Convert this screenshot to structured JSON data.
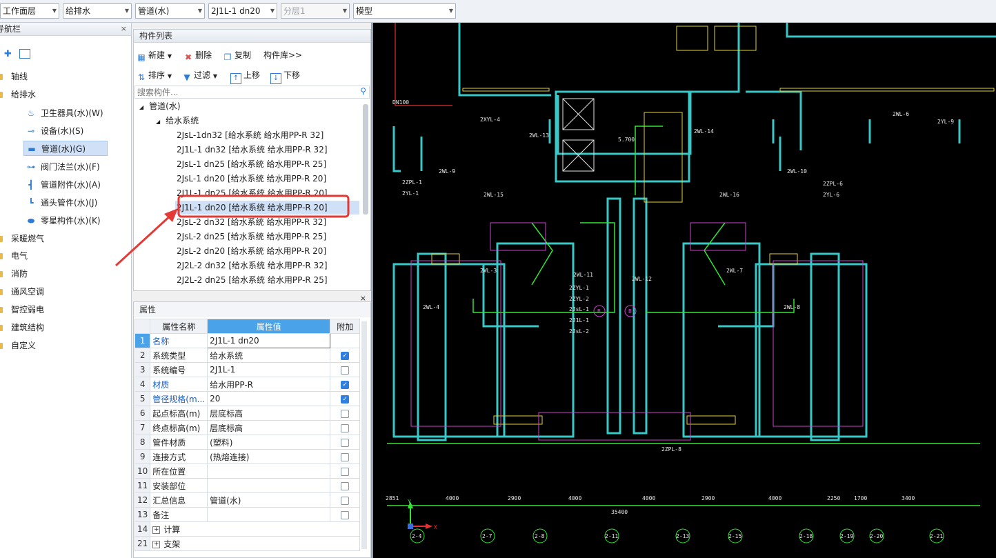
{
  "toolbar": {
    "combos": [
      {
        "value": "工作面层",
        "disabled": false
      },
      {
        "value": "给排水",
        "disabled": false
      },
      {
        "value": "管道(水)",
        "disabled": false
      },
      {
        "value": "2J1L-1 dn20",
        "disabled": false
      },
      {
        "value": "分层1",
        "disabled": true
      },
      {
        "value": "模型",
        "disabled": false
      }
    ]
  },
  "nav": {
    "title": "导航栏",
    "close": "×",
    "categories": [
      {
        "label": "轴线"
      },
      {
        "label": "给排水"
      },
      {
        "label": "采暖燃气"
      },
      {
        "label": "电气"
      },
      {
        "label": "消防"
      },
      {
        "label": "通风空调"
      },
      {
        "label": "智控弱电"
      },
      {
        "label": "建筑结构"
      },
      {
        "label": "自定义"
      }
    ],
    "sub_items": [
      {
        "label": "卫生器具(水)(W)",
        "icon": "sink-icon"
      },
      {
        "label": "设备(水)(S)",
        "icon": "equipment-icon"
      },
      {
        "label": "管道(水)(G)",
        "icon": "pipe-icon"
      },
      {
        "label": "阀门法兰(水)(F)",
        "icon": "valve-icon"
      },
      {
        "label": "管道附件(水)(A)",
        "icon": "fitting-icon"
      },
      {
        "label": "通头管件(水)(J)",
        "icon": "elbow-icon"
      },
      {
        "label": "零星构件(水)(K)",
        "icon": "misc-icon"
      }
    ],
    "selected_sub_index": 2
  },
  "component_list": {
    "title": "构件列表",
    "close": "×",
    "buttons": {
      "new": "新建",
      "delete": "删除",
      "copy": "复制",
      "library": "构件库>>",
      "sort": "排序",
      "filter": "过滤",
      "move_up": "上移",
      "move_down": "下移"
    },
    "search_placeholder": "搜索构件...",
    "tree_root": "管道(水)",
    "tree_group": "给水系统",
    "items": [
      "2JsL-1dn32 [给水系统 给水用PP-R 32]",
      "2J1L-1 dn32 [给水系统 给水用PP-R 32]",
      "2JsL-1 dn25 [给水系统 给水用PP-R 25]",
      "2JsL-1 dn20 [给水系统 给水用PP-R 20]",
      "2J1L-1 dn25 [给水系统 给水用PP-R 20]",
      "2J1L-1 dn20 [给水系统 给水用PP-R 20]",
      "2JsL-2 dn32 [给水系统 给水用PP-R 32]",
      "2JsL-2 dn25 [给水系统 给水用PP-R 25]",
      "2JsL-2 dn20 [给水系统 给水用PP-R 20]",
      "2J2L-2 dn32 [给水系统 给水用PP-R 32]",
      "2J2L-2 dn25 [给水系统 给水用PP-R 25]"
    ],
    "selected_index": 5
  },
  "properties": {
    "title": "属性",
    "close": "×",
    "headers": {
      "name": "属性名称",
      "value": "属性值",
      "extra": "附加"
    },
    "rows": [
      {
        "num": "1",
        "name": "名称",
        "value": "2J1L-1 dn20",
        "blue": true,
        "checkbox": null
      },
      {
        "num": "2",
        "name": "系统类型",
        "value": "给水系统",
        "blue": false,
        "checkbox": true
      },
      {
        "num": "3",
        "name": "系统编号",
        "value": "2J1L-1",
        "blue": false,
        "checkbox": false
      },
      {
        "num": "4",
        "name": "材质",
        "value": "给水用PP-R",
        "blue": true,
        "checkbox": true
      },
      {
        "num": "5",
        "name": "管径规格(m...",
        "value": "20",
        "blue": true,
        "checkbox": true
      },
      {
        "num": "6",
        "name": "起点标高(m)",
        "value": "层底标高",
        "blue": false,
        "checkbox": false
      },
      {
        "num": "7",
        "name": "终点标高(m)",
        "value": "层底标高",
        "blue": false,
        "checkbox": false
      },
      {
        "num": "8",
        "name": "管件材质",
        "value": "(塑料)",
        "blue": false,
        "checkbox": false
      },
      {
        "num": "9",
        "name": "连接方式",
        "value": "(热熔连接)",
        "blue": false,
        "checkbox": false
      },
      {
        "num": "10",
        "name": "所在位置",
        "value": "",
        "blue": false,
        "checkbox": false
      },
      {
        "num": "11",
        "name": "安装部位",
        "value": "",
        "blue": false,
        "checkbox": false
      },
      {
        "num": "12",
        "name": "汇总信息",
        "value": "管道(水)",
        "blue": false,
        "checkbox": false
      },
      {
        "num": "13",
        "name": "备注",
        "value": "",
        "blue": false,
        "checkbox": false
      },
      {
        "num": "14",
        "name": "计算",
        "value": "",
        "blue": false,
        "checkbox": null,
        "group": true
      },
      {
        "num": "21",
        "name": "支架",
        "value": "",
        "blue": false,
        "checkbox": null,
        "group": true
      }
    ]
  },
  "cad": {
    "dimensions": [
      "2851",
      "4000",
      "2900",
      "4000",
      "4000",
      "2900",
      "4000",
      "2250",
      "1700",
      "3400"
    ],
    "total": "35400",
    "axes": [
      "2-4",
      "2-7",
      "2-8",
      "2-11",
      "2-13",
      "2-15",
      "2-18",
      "2-19",
      "2-20",
      "2-21"
    ],
    "ucs": {
      "x": "X",
      "y": "Y"
    },
    "labels": {
      "top_mid": "5.700",
      "dn100": "DN100",
      "riser_left": [
        "2ZPL-1",
        "2YL-1"
      ],
      "riser_right": [
        "2ZPL-6",
        "2YL-6"
      ],
      "c_labels": [
        "2ZYL-1",
        "2ZYL-2",
        "2JsL-1",
        "2J1L-1",
        "2JsL-2"
      ],
      "tags": [
        "2WL-13",
        "2WL-14",
        "2WL-9",
        "2WL-10",
        "2WL-15",
        "2WL-16",
        "2WL-11",
        "2WL-12",
        "2WL-6",
        "2WL-3",
        "2WL-7",
        "2WL-4",
        "2WL-8",
        "2XYL-4",
        "2ZPL-8",
        "2YL-9"
      ],
      "room_b": "B"
    }
  },
  "colors": {
    "accent": "#2f7fe0",
    "selection": "#cfe0f7",
    "highlight_box": "#e53935",
    "arrow": "#e53935"
  }
}
